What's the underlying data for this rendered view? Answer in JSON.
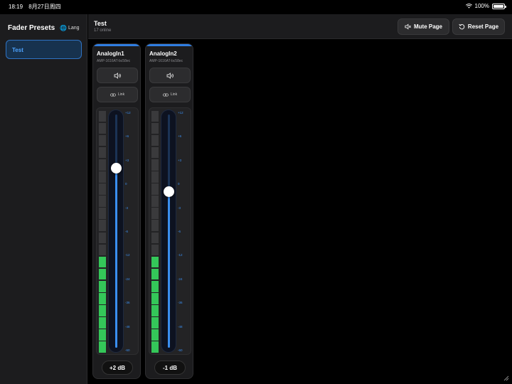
{
  "status": {
    "time": "18:19",
    "date": "8月27日周四",
    "battery": "100%"
  },
  "sidebar": {
    "title": "Fader Presets",
    "lang_label": "Lang",
    "presets": [
      {
        "label": "Test",
        "selected": true
      }
    ]
  },
  "header": {
    "title": "Test",
    "subtitle": "17 online",
    "mute_label": "Mute Page",
    "reset_label": "Reset Page"
  },
  "scale_ticks": [
    "+12",
    "+6",
    "+3",
    "0",
    "-3",
    "-6",
    "-12",
    "-24",
    "-36",
    "-48",
    "-60"
  ],
  "channels": [
    {
      "name": "AnalogIn1",
      "device": "AMP-1616AT-bc58ec",
      "link_label": "Link",
      "db_label": "+2 dB",
      "fader_level": 0.77,
      "meter_lit_segments": 8,
      "meter_total_segments": 20
    },
    {
      "name": "AnalogIn2",
      "device": "AMP-1616AT-bc58ec",
      "link_label": "Link",
      "db_label": "-1 dB",
      "fader_level": 0.67,
      "meter_lit_segments": 8,
      "meter_total_segments": 20
    }
  ],
  "colors": {
    "accent": "#2f7de1",
    "meter_on": "#34c759",
    "meter_off": "#3a3a3c",
    "fill": "#3a8ef0"
  }
}
